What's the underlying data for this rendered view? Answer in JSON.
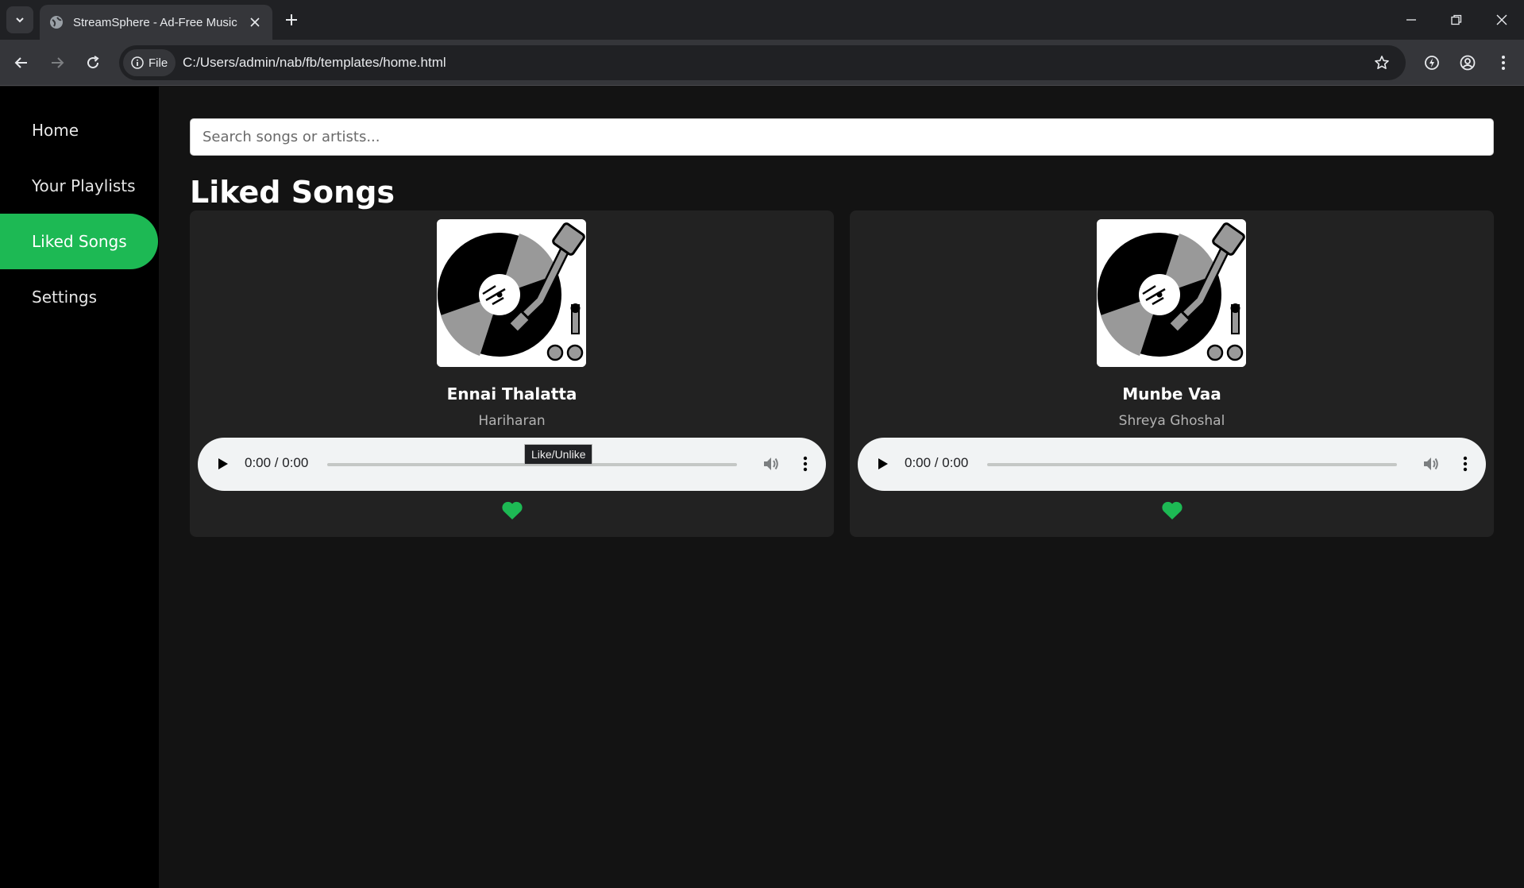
{
  "browser": {
    "tab_title": "StreamSphere - Ad-Free Music",
    "file_chip_label": "File",
    "url": "C:/Users/admin/nab/fb/templates/home.html"
  },
  "sidebar": {
    "items": [
      {
        "label": "Home",
        "active": false
      },
      {
        "label": "Your Playlists",
        "active": false
      },
      {
        "label": "Liked Songs",
        "active": true
      },
      {
        "label": "Settings",
        "active": false
      }
    ]
  },
  "search": {
    "placeholder": "Search songs or artists..."
  },
  "main": {
    "heading": "Liked Songs",
    "songs": [
      {
        "title": "Ennai Thalatta",
        "artist": "Hariharan",
        "time": "0:00 / 0:00",
        "progress": 0,
        "liked": true
      },
      {
        "title": "Munbe Vaa",
        "artist": "Shreya Ghoshal",
        "time": "0:00 / 0:00",
        "progress": 0,
        "liked": true
      }
    ]
  },
  "tooltip": {
    "text": "Like/Unlike"
  },
  "colors": {
    "accent": "#1db954",
    "page_bg": "#131313",
    "sidebar_bg": "#000000",
    "card_bg": "#222222"
  }
}
